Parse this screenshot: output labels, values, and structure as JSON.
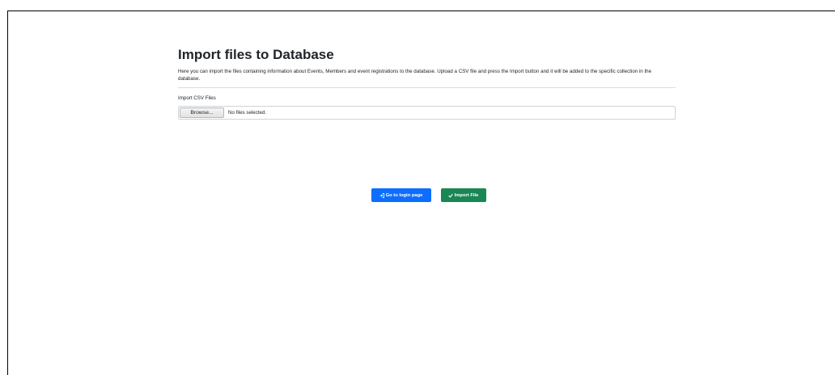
{
  "page": {
    "title": "Import files to Database",
    "description": "Here you can import the files containing information about Events, Members and event registrations to the database. Upload a CSV file and press the Import button and it will be added to the specific collection in the database."
  },
  "form": {
    "label": "Import CSV Files",
    "browse_label": "Browse...",
    "file_status": "No files selected."
  },
  "actions": {
    "login_label": "Go to login page",
    "import_label": "Import File"
  },
  "icons": {
    "login": "sign-in-icon",
    "import": "check-icon"
  },
  "colors": {
    "primary": "#0d6efd",
    "success": "#198754"
  }
}
